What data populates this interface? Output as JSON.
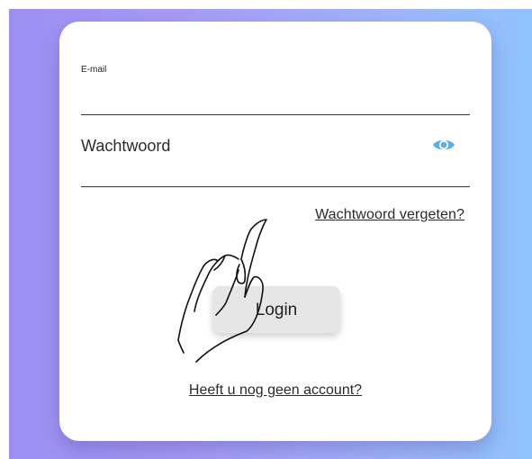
{
  "login_form": {
    "email_label": "E-mail",
    "email_value": "",
    "password_placeholder": "Wachtwoord",
    "password_value": "",
    "show_password_icon": "eye-icon",
    "forgot_password_link": "Wachtwoord vergeten?",
    "login_button": "Login",
    "signup_link": "Heeft u nog geen account?"
  },
  "colors": {
    "background_gradient_start": "#9c8ff2",
    "background_gradient_end": "#8fc3fb",
    "eye_icon": "#5aaeee",
    "button_background": "#e6e6e6",
    "card_background": "#ffffff"
  },
  "overlay": {
    "cursor_icon": "hand-pointer-icon"
  }
}
